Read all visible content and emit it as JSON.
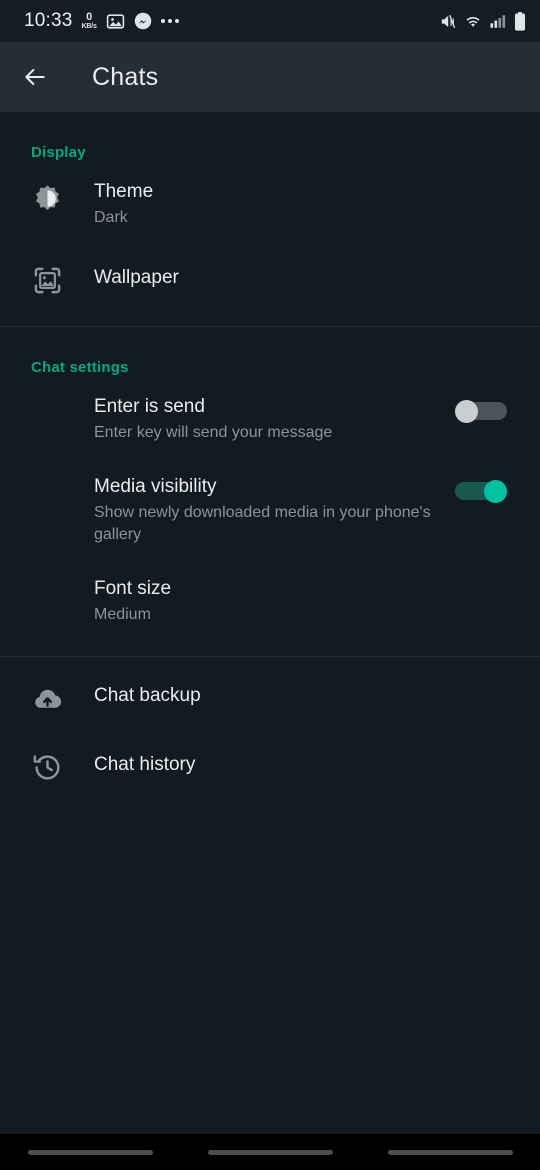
{
  "status_bar": {
    "time": "10:33",
    "net_speed_value": "0",
    "net_speed_unit": "KB/s",
    "icons": [
      "gallery-icon",
      "messenger-icon",
      "overflow-dots-icon",
      "vibrate-mute-icon",
      "wifi-icon",
      "cellular-signal-icon",
      "battery-icon"
    ]
  },
  "app_bar": {
    "back_icon": "back-arrow-icon",
    "title": "Chats"
  },
  "sections": [
    {
      "id": "display",
      "title": "Display",
      "rows": [
        {
          "id": "theme",
          "icon": "brightness-contrast-icon",
          "title": "Theme",
          "subtitle": "Dark",
          "toggle": null
        },
        {
          "id": "wallpaper",
          "icon": "wallpaper-image-icon",
          "title": "Wallpaper",
          "subtitle": "",
          "toggle": null
        }
      ]
    },
    {
      "id": "chat-settings",
      "title": "Chat settings",
      "rows": [
        {
          "id": "enter-is-send",
          "icon": "",
          "title": "Enter is send",
          "subtitle": "Enter key will send your message",
          "toggle": "off"
        },
        {
          "id": "media-visibility",
          "icon": "",
          "title": "Media visibility",
          "subtitle": "Show newly downloaded media in your phone's gallery",
          "toggle": "on"
        },
        {
          "id": "font-size",
          "icon": "",
          "title": "Font size",
          "subtitle": "Medium",
          "toggle": null
        }
      ]
    },
    {
      "id": "backup",
      "title": "",
      "rows": [
        {
          "id": "chat-backup",
          "icon": "cloud-upload-icon",
          "title": "Chat backup",
          "subtitle": "",
          "toggle": null
        },
        {
          "id": "chat-history",
          "icon": "history-clock-icon",
          "title": "Chat history",
          "subtitle": "",
          "toggle": null
        }
      ]
    }
  ],
  "nav_bar": {
    "items": [
      "recents-pill",
      "home-pill",
      "back-pill"
    ]
  },
  "colors": {
    "accent_teal": "#00a884",
    "background": "#111b21",
    "appbar": "#252d36",
    "primary_text": "#e9edef",
    "secondary_text": "#8696a0",
    "toggle_on": "#00c4a0",
    "toggle_off_knob": "#c9ced1"
  }
}
